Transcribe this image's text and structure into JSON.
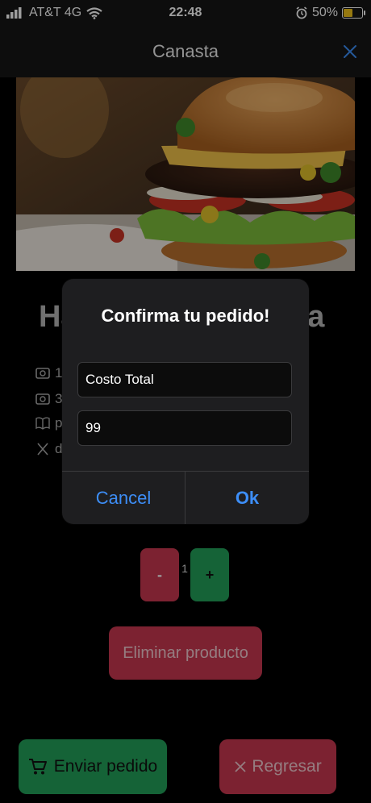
{
  "status_bar": {
    "carrier": "AT&T 4G",
    "time": "22:48",
    "battery": "50%",
    "battery_level": 0.5
  },
  "nav": {
    "title": "Canasta",
    "close_icon": "close-icon"
  },
  "product": {
    "title_start": "Ha",
    "title_end": "na",
    "rows": [
      {
        "icon": "money-icon",
        "text": "1"
      },
      {
        "icon": "money-icon",
        "text": "3"
      },
      {
        "icon": "book-icon",
        "text": "p"
      },
      {
        "icon": "utensils-icon",
        "text": "d"
      }
    ]
  },
  "stepper": {
    "minus": "-",
    "quantity": "1",
    "plus": "+"
  },
  "actions": {
    "delete": "Eliminar producto",
    "send": "Enviar pedido",
    "back": "Regresar"
  },
  "alert": {
    "title": "Confirma tu pedido!",
    "field1_value": "Costo Total",
    "field2_value": "99",
    "cancel": "Cancel",
    "ok": "Ok"
  },
  "colors": {
    "accent_blue": "#3d8ef7",
    "danger": "#c8384f",
    "success": "#22a05a",
    "battery": "#f2c31b"
  }
}
